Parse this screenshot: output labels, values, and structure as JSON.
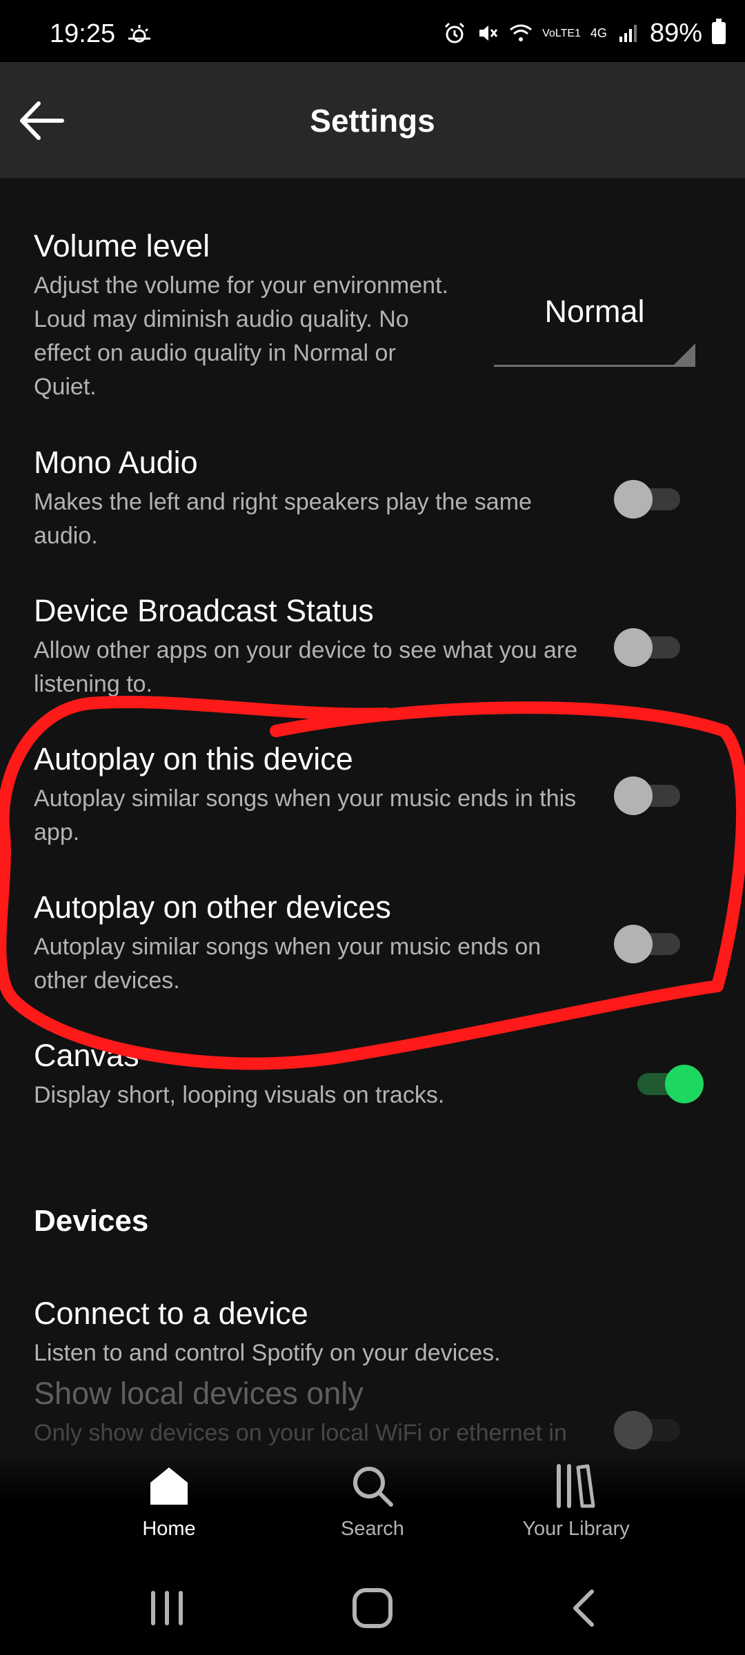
{
  "status_bar": {
    "time": "19:25",
    "network_top": "VoLTE1",
    "network_type": "4G",
    "battery": "89%"
  },
  "header": {
    "title": "Settings"
  },
  "settings": {
    "volume": {
      "title": "Volume level",
      "desc": "Adjust the volume for your environment. Loud may diminish audio quality. No effect on audio quality in Normal or Quiet.",
      "value": "Normal"
    },
    "mono": {
      "title": "Mono Audio",
      "desc": "Makes the left and right speakers play the same audio.",
      "on": false
    },
    "broadcast": {
      "title": "Device Broadcast Status",
      "desc": "Allow other apps on your device to see what you are listening to.",
      "on": false
    },
    "autoplay_this": {
      "title": "Autoplay on this device",
      "desc": "Autoplay similar songs when your music ends in this app.",
      "on": false
    },
    "autoplay_other": {
      "title": "Autoplay on other devices",
      "desc": "Autoplay similar songs when your music ends on other devices.",
      "on": false
    },
    "canvas": {
      "title": "Canvas",
      "desc": "Display short, looping visuals on tracks.",
      "on": true
    }
  },
  "devices": {
    "section_title": "Devices",
    "connect": {
      "title": "Connect to a device",
      "desc": "Listen to and control Spotify on your devices."
    },
    "local_only": {
      "title": "Show local devices only",
      "desc": "Only show devices on your local WiFi or ethernet in the devices menu.",
      "on": false
    }
  },
  "bottom_nav": {
    "items": [
      {
        "label": "Home",
        "icon": "home-icon",
        "active": true
      },
      {
        "label": "Search",
        "icon": "search-icon",
        "active": false
      },
      {
        "label": "Your Library",
        "icon": "library-icon",
        "active": false
      }
    ]
  },
  "system_nav": {
    "icons": [
      "recents-icon",
      "home-circle-icon",
      "back-chevron-icon"
    ]
  },
  "colors": {
    "background": "#121212",
    "header": "#282828",
    "accent_green": "#1ed760",
    "annotation_red": "#ff1a1a"
  }
}
